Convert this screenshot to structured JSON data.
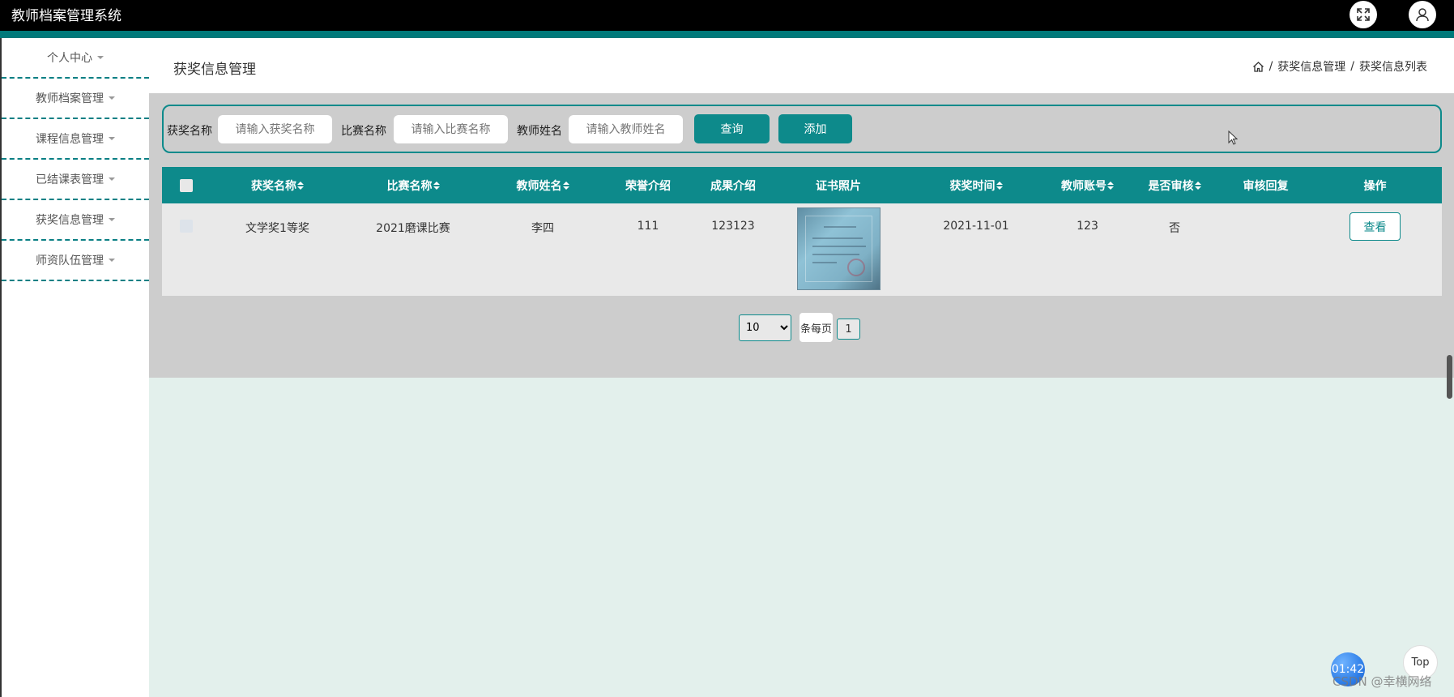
{
  "app": {
    "title": "教师档案管理系统"
  },
  "header": {
    "fullscreen_icon": "expand-icon",
    "user_icon": "user-icon"
  },
  "sidebar": {
    "items": [
      {
        "label": "个人中心"
      },
      {
        "label": "教师档案管理"
      },
      {
        "label": "课程信息管理"
      },
      {
        "label": "已结课表管理"
      },
      {
        "label": "获奖信息管理"
      },
      {
        "label": "师资队伍管理"
      }
    ]
  },
  "page": {
    "title": "获奖信息管理",
    "breadcrumb": {
      "home_icon": "home-icon",
      "sep": "/",
      "level1": "获奖信息管理",
      "level2": "获奖信息列表"
    }
  },
  "search": {
    "award_label": "获奖名称",
    "award_placeholder": "请输入获奖名称",
    "contest_label": "比赛名称",
    "contest_placeholder": "请输入比赛名称",
    "teacher_label": "教师姓名",
    "teacher_placeholder": "请输入教师姓名",
    "query_button": "查询",
    "add_button": "添加"
  },
  "table": {
    "columns": [
      "获奖名称",
      "比赛名称",
      "教师姓名",
      "荣誉介绍",
      "成果介绍",
      "证书照片",
      "获奖时间",
      "教师账号",
      "是否审核",
      "审核回复",
      "操作"
    ],
    "rows": [
      {
        "award": "文学奖1等奖",
        "contest": "2021磨课比赛",
        "teacher": "李四",
        "honor": "111",
        "result": "123123",
        "photo": "certificate-image",
        "time": "2021-11-01",
        "account": "123",
        "reviewed": "否",
        "reply": "",
        "action": "查看"
      }
    ]
  },
  "pagination": {
    "page_size": "10",
    "per_page_label": "条每页",
    "current_page": "1"
  },
  "widgets": {
    "timer": "01:42",
    "top": "Top",
    "watermark": "CSDN @幸横网络"
  },
  "colors": {
    "primary": "#0d8a8b",
    "topbar": "#000000",
    "content_bg": "#e3f0ec",
    "panel_bg": "#cdcdcd"
  }
}
